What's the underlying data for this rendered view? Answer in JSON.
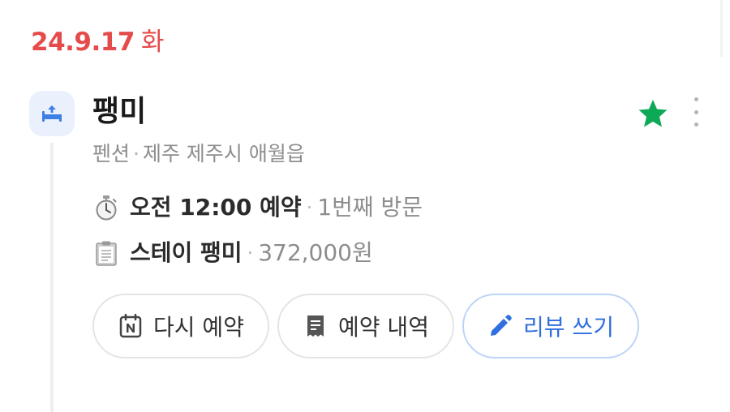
{
  "date_header": {
    "date": "24.9.17",
    "weekday": "화"
  },
  "colors": {
    "date_accent": "#e54b4b",
    "brand_blue": "#2f6fde",
    "favorite_green": "#0ea957"
  },
  "place": {
    "category_icon": "bed-icon",
    "name": "팽미",
    "category": "펜션",
    "location": "제주 제주시 애월읍",
    "favorite_icon": "star-icon",
    "more_icon": "more-vertical-icon"
  },
  "reservation": {
    "time_icon": "stopwatch-icon",
    "time_text": "오전 12:00 예약",
    "visit_text": "1번째 방문",
    "product_icon": "clipboard-icon",
    "product_name": "스테이 팽미",
    "price": "372,000원"
  },
  "actions": [
    {
      "label": "다시 예약",
      "icon": "naver-calendar-icon"
    },
    {
      "label": "예약 내역",
      "icon": "receipt-icon"
    },
    {
      "label": "리뷰 쓰기",
      "icon": "pencil-icon"
    }
  ]
}
